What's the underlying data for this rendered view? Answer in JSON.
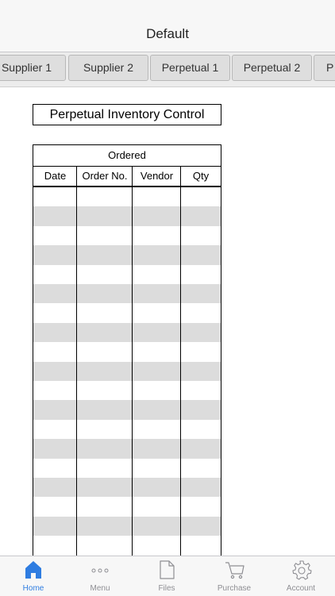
{
  "navbar": {
    "title": "Default"
  },
  "tabs": [
    {
      "label": "Supplier 1"
    },
    {
      "label": "Supplier 2"
    },
    {
      "label": "Perpetual 1"
    },
    {
      "label": "Perpetual 2"
    },
    {
      "label": "P"
    }
  ],
  "document": {
    "title": "Perpetual Inventory Control",
    "section": "Ordered",
    "columns": [
      "Date",
      "Order No.",
      "Vendor",
      "Qty"
    ]
  },
  "tabbar": {
    "items": [
      {
        "label": "Home",
        "icon": "home-icon",
        "active": true
      },
      {
        "label": "Menu",
        "icon": "more-icon",
        "active": false
      },
      {
        "label": "Files",
        "icon": "file-icon",
        "active": false
      },
      {
        "label": "Purchase",
        "icon": "cart-icon",
        "active": false
      },
      {
        "label": "Account",
        "icon": "gear-icon",
        "active": false
      }
    ],
    "active_color": "#2f7de1",
    "inactive_color": "#8e8e93"
  }
}
